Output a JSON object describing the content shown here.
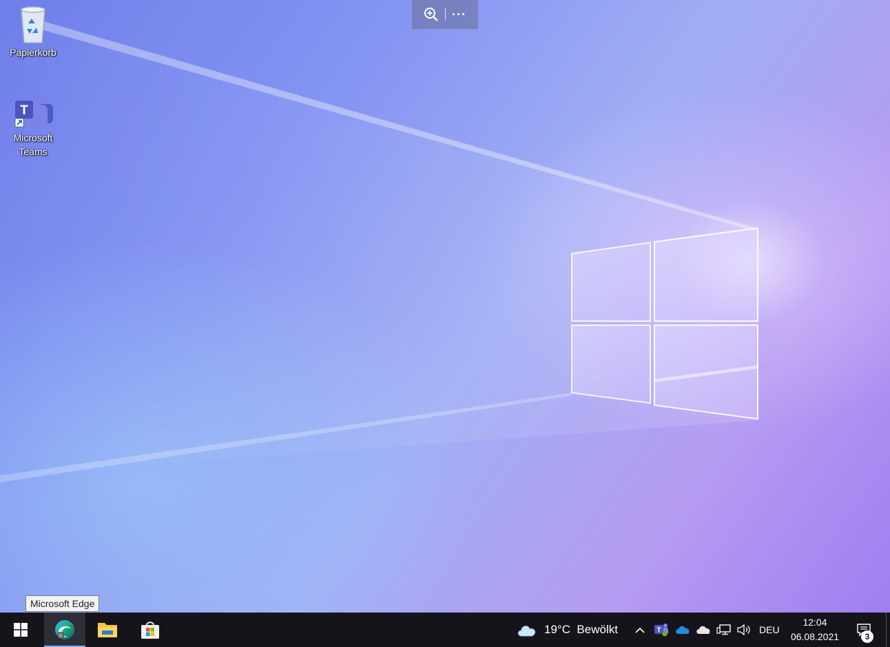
{
  "desktop": {
    "icons": [
      {
        "label": "Papierkorb",
        "icon": "recycle-bin-icon"
      },
      {
        "label": "Microsoft\nTeams",
        "icon": "teams-icon"
      }
    ]
  },
  "zoom_toolbar": {
    "zoom_icon": "zoom-in-icon",
    "more_icon": "more-options-icon",
    "more_label": "···"
  },
  "tooltip": {
    "text": "Microsoft Edge"
  },
  "taskbar": {
    "apps": [
      {
        "name": "start",
        "icon": "windows-start-icon"
      },
      {
        "name": "edge",
        "icon": "edge-browser-icon",
        "active": true
      },
      {
        "name": "explorer",
        "icon": "file-explorer-icon"
      },
      {
        "name": "store",
        "icon": "store-icon"
      }
    ],
    "weather": {
      "icon": "cloud-weather-icon",
      "text": "19°C  Bewölkt"
    },
    "tray": {
      "chevron": "^",
      "icons": [
        "teams-tray-icon",
        "onedrive-icon",
        "onedrive-gray-icon",
        "network-icon",
        "volume-icon"
      ],
      "language": "DEU"
    },
    "clock": {
      "time": "12:04",
      "date": "06.08.2021"
    },
    "notifications": {
      "icon": "action-center-icon",
      "count": "3"
    }
  },
  "colors": {
    "taskbar": "#15141b",
    "accent": "#7da9e8"
  }
}
